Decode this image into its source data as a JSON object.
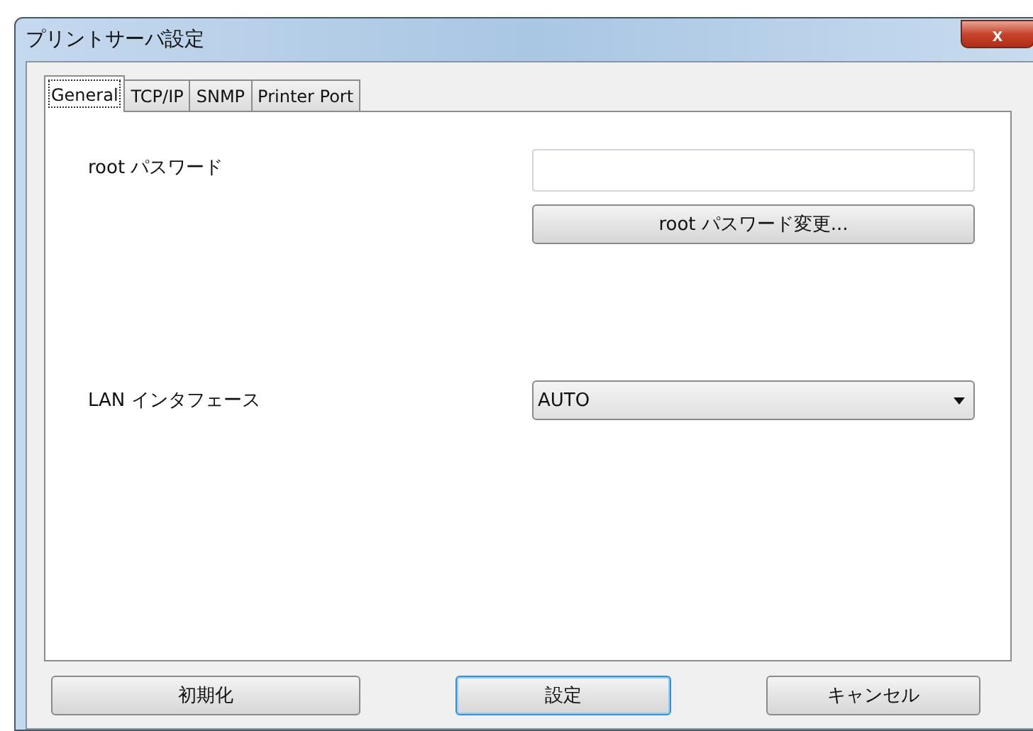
{
  "window": {
    "title": "プリントサーバ設定",
    "close_label": "x"
  },
  "tabs": [
    {
      "label": "General",
      "selected": true
    },
    {
      "label": "TCP/IP",
      "selected": false
    },
    {
      "label": "SNMP",
      "selected": false
    },
    {
      "label": "Printer Port",
      "selected": false
    }
  ],
  "settings": [
    {
      "kind": "password",
      "label": "root パスワード",
      "button": "root パスワード変更..."
    },
    {
      "kind": "dropdown",
      "label": "LAN インタフェース",
      "value": "AUTO"
    }
  ],
  "buttons": [
    {
      "label": "初期化",
      "default": false
    },
    {
      "label": "設定",
      "default": true
    },
    {
      "label": "キャンセル",
      "default": false
    }
  ]
}
